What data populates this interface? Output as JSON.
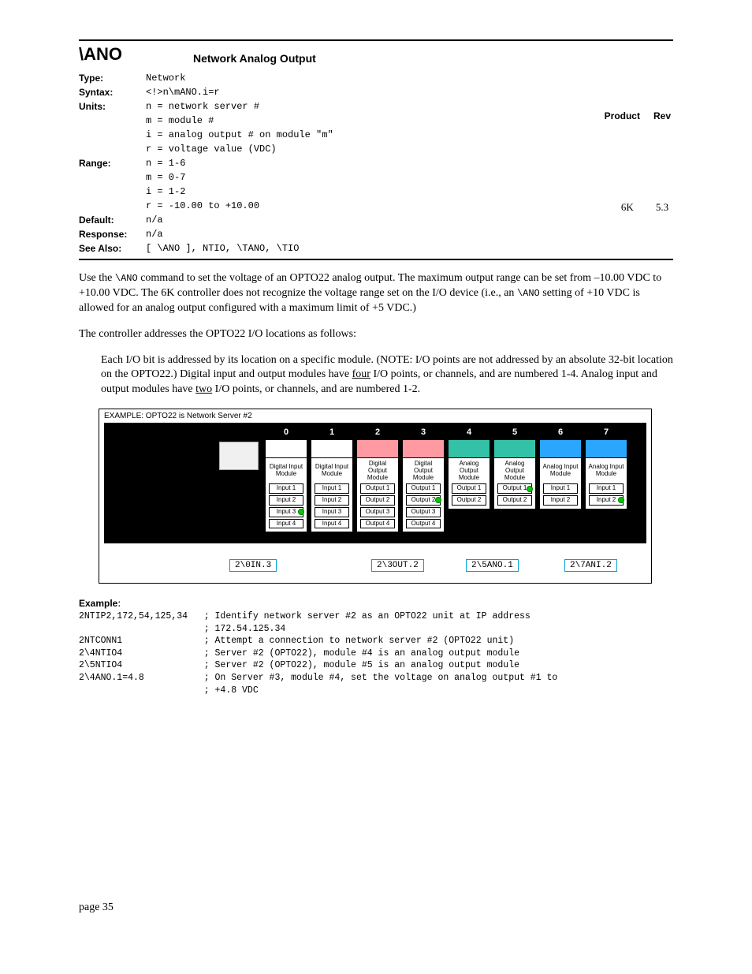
{
  "command": {
    "name": "\\ANO",
    "title": "Network Analog Output"
  },
  "spec": {
    "type": "Network",
    "syntax": "<!>n\\mANO.i=r",
    "units": [
      "n = network server #",
      "m = module #",
      "i = analog output # on module \"m\"",
      "r = voltage value (VDC)"
    ],
    "range": [
      "n = 1-6",
      "m = 0-7",
      "i = 1-2",
      "r = -10.00 to +10.00"
    ],
    "default": "n/a",
    "response": "n/a",
    "see_also": "[ \\ANO ], NTIO, \\TANO, \\TIO"
  },
  "prodrev": {
    "product_h": "Product",
    "rev_h": "Rev",
    "product": "6K",
    "rev": "5.3"
  },
  "labels": {
    "type": "Type:",
    "syntax": "Syntax:",
    "units": "Units:",
    "range": "Range:",
    "default": "Default:",
    "response": "Response:",
    "see_also": "See Also:",
    "example": "Example"
  },
  "para1a": "Use the ",
  "para1_cmd": "\\ANO",
  "para1b": " command to set the voltage of an OPTO22 analog output. The maximum output range can be set from –10.00 VDC to +10.00 VDC.  The 6K controller does not recognize the voltage range set on the I/O device (i.e., an ",
  "para1_cmd2": "\\ANO",
  "para1c": " setting of +10 VDC is allowed for an analog output configured with a maximum limit of +5 VDC.)",
  "para2": "The controller addresses the OPTO22 I/O locations as follows:",
  "para3a": "Each I/O bit is addressed by its location on a specific module. (NOTE: I/O points are not addressed by an absolute 32-bit location on the OPTO22.) Digital input and output modules have ",
  "para3_u1": "four",
  "para3b": " I/O points, or channels, and are numbered 1-4. Analog input and output modules have ",
  "para3_u2": "two",
  "para3c": " I/O points, or channels, and are numbered 1-2.",
  "diagram": {
    "title": "EXAMPLE: OPTO22 is Network Server #2",
    "modules": [
      {
        "num": "0",
        "cap": "#ffffff",
        "type": "Digital Input Module",
        "slots": [
          "Input 1",
          "Input 2",
          "Input 3",
          "Input 4"
        ],
        "dot": 2
      },
      {
        "num": "1",
        "cap": "#ffffff",
        "type": "Digital Input Module",
        "slots": [
          "Input 1",
          "Input 2",
          "Input 3",
          "Input 4"
        ]
      },
      {
        "num": "2",
        "cap": "#ff9aa2",
        "type": "Digital Output Module",
        "slots": [
          "Output 1",
          "Output 2",
          "Output 3",
          "Output 4"
        ]
      },
      {
        "num": "3",
        "cap": "#ff9aa2",
        "type": "Digital Output Module",
        "slots": [
          "Output 1",
          "Output 2",
          "Output 3",
          "Output 4"
        ],
        "dot": 1
      },
      {
        "num": "4",
        "cap": "#33c2a8",
        "type": "Analog Output Module",
        "slots": [
          "Output 1",
          "Output 2"
        ]
      },
      {
        "num": "5",
        "cap": "#33c2a8",
        "type": "Analog Output Module",
        "slots": [
          "Output 1",
          "Output 2"
        ],
        "dot": 0
      },
      {
        "num": "6",
        "cap": "#2aa6ff",
        "type": "Analog Input Module",
        "slots": [
          "Input 1",
          "Input 2"
        ]
      },
      {
        "num": "7",
        "cap": "#2aa6ff",
        "type": "Analog Input Module",
        "slots": [
          "Input 1",
          "Input 2"
        ],
        "dot": 1
      }
    ],
    "callouts": [
      "2\\0IN.3",
      "2\\3OUT.2",
      "2\\5ANO.1",
      "2\\7ANI.2"
    ]
  },
  "example_lines": [
    {
      "cmd": "2NTIP2,172,54,125,34",
      "cmt": "; Identify network server #2 as an OPTO22 unit at IP address"
    },
    {
      "cmd": "",
      "cmt": "; 172.54.125.34"
    },
    {
      "cmd": "2NTCONN1",
      "cmt": "; Attempt a connection to network server #2 (OPTO22 unit)"
    },
    {
      "cmd": "2\\4NTIO4",
      "cmt": "; Server #2 (OPTO22), module #4 is an analog output module"
    },
    {
      "cmd": "2\\5NTIO4",
      "cmt": "; Server #2 (OPTO22), module #5 is an analog output module"
    },
    {
      "cmd": "2\\4ANO.1=4.8",
      "cmt": "; On Server #3, module #4, set the voltage on analog output #1 to"
    },
    {
      "cmd": "",
      "cmt": "; +4.8 VDC"
    }
  ],
  "page": "page 35"
}
